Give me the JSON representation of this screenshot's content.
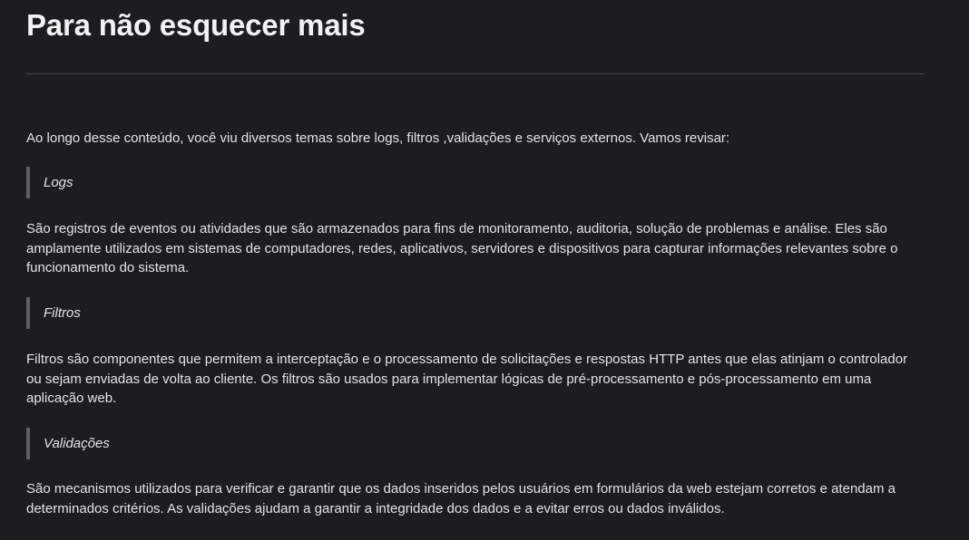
{
  "title": "Para não esquecer mais",
  "intro": "Ao longo desse conteúdo, você viu diversos temas sobre logs, filtros ,validações e serviços externos. Vamos revisar:",
  "sections": [
    {
      "heading": "Logs",
      "text": "São registros de eventos ou atividades que são armazenados para fins de monitoramento, auditoria, solução de problemas e análise. Eles são amplamente utilizados em sistemas de computadores, redes, aplicativos, servidores e dispositivos para capturar informações relevantes sobre o funcionamento do sistema."
    },
    {
      "heading": "Filtros",
      "text": "Filtros são componentes que permitem a interceptação e o processamento de solicitações e respostas HTTP antes que elas atinjam o controlador ou sejam enviadas de volta ao cliente. Os filtros são usados para implementar lógicas de pré-processamento e pós-processamento em uma aplicação web."
    },
    {
      "heading": "Validações",
      "text": "São mecanismos utilizados para verificar e garantir que os dados inseridos pelos usuários em formulários da web estejam corretos e atendam a determinados critérios. As validações ajudam a garantir a integridade dos dados e a evitar erros ou dados inválidos."
    }
  ]
}
